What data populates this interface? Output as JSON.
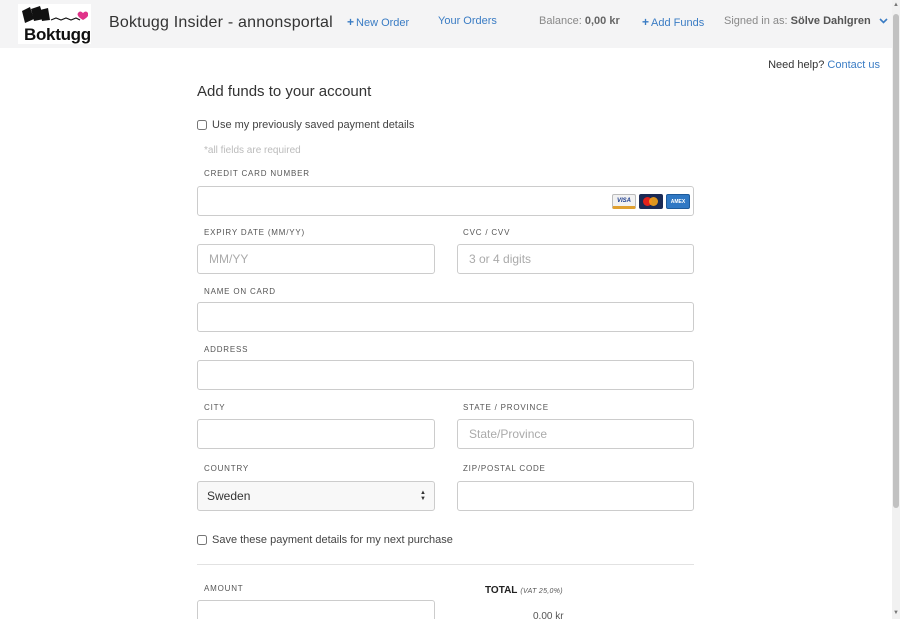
{
  "header": {
    "logo_text": "Boktugg",
    "app_title": "Boktugg Insider - annonsportal",
    "new_order": "New Order",
    "your_orders": "Your Orders",
    "balance_label": "Balance:",
    "balance_value": "0,00 kr",
    "add_funds": "Add Funds",
    "signed_in_label": "Signed in as:",
    "user_name": "Sölve Dahlgren"
  },
  "help": {
    "text": "Need help?",
    "link": "Contact us"
  },
  "form": {
    "title": "Add funds to your account",
    "use_saved": "Use my previously saved payment details",
    "required_note": "*all fields are required",
    "card_number_label": "Credit card number",
    "expiry_label": "Expiry date (MM/YY)",
    "expiry_placeholder": "MM/YY",
    "cvc_label": "CVC / CVV",
    "cvc_placeholder": "3 or 4 digits",
    "name_label": "Name on card",
    "address_label": "Address",
    "city_label": "City",
    "state_label": "State / Province",
    "state_placeholder": "State/Province",
    "country_label": "Country",
    "country_value": "Sweden",
    "zip_label": "ZIP/Postal code",
    "save_details": "Save these payment details for my next purchase",
    "amount_label": "Amount",
    "total_label": "TOTAL",
    "vat_note": "(VAT 25,0%)",
    "total_value": "0,00 kr"
  },
  "card_brands": [
    "VISA",
    "mastercard",
    "AMEX"
  ],
  "colors": {
    "accent": "#3a7cc4",
    "topbar": "#f4f4f5"
  }
}
